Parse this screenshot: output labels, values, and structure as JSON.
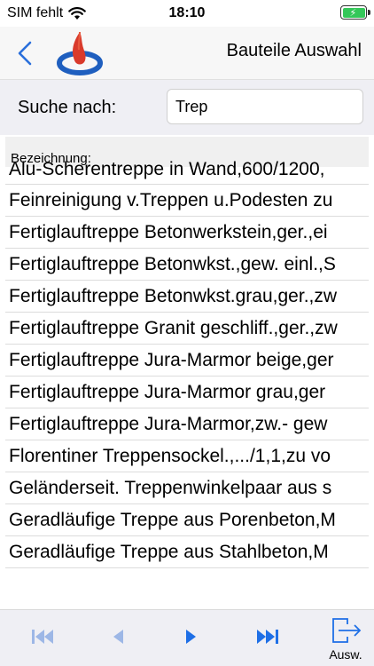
{
  "status_bar": {
    "carrier": "SIM fehlt",
    "time": "18:10",
    "wifi_icon": "wifi-icon",
    "battery_icon": "battery-charging-icon"
  },
  "nav": {
    "back_icon": "chevron-left-icon",
    "logo_icon": "flame-logo-icon",
    "title": "Bauteile Auswahl"
  },
  "search": {
    "label": "Suche nach:",
    "value": "Trep"
  },
  "list": {
    "header": "Bezeichnung:",
    "items": [
      "Alu-Scherentreppe in Wand,600/1200,",
      "Feinreinigung v.Treppen u.Podesten zu",
      "Fertiglauftreppe Betonwerkstein,ger.,ei",
      "Fertiglauftreppe Betonwkst.,gew. einl.,S",
      "Fertiglauftreppe Betonwkst.grau,ger.,zw",
      "Fertiglauftreppe Granit geschliff.,ger.,zw",
      "Fertiglauftreppe Jura-Marmor beige,ger",
      "Fertiglauftreppe Jura-Marmor grau,ger",
      "Fertiglauftreppe Jura-Marmor,zw.- gew",
      "Florentiner Treppensockel.,.../1,1,zu vo",
      "Geländerseit. Treppenwinkelpaar aus s",
      "Geradläufige Treppe aus Porenbeton,M",
      "Geradläufige Treppe aus Stahlbeton,M"
    ]
  },
  "toolbar": {
    "first_icon": "skip-first-icon",
    "prev_icon": "play-left-icon",
    "next_icon": "play-right-icon",
    "last_icon": "skip-last-icon",
    "select_label": "Ausw.",
    "select_icon": "export-arrow-icon"
  },
  "colors": {
    "accent": "#2a6fdb",
    "toolbar_icon": "#1e6fe6",
    "toolbar_icon_faded": "#9db7e6",
    "battery": "#34c759",
    "logo_red": "#d93a2b",
    "logo_blue": "#1f5fbf"
  }
}
